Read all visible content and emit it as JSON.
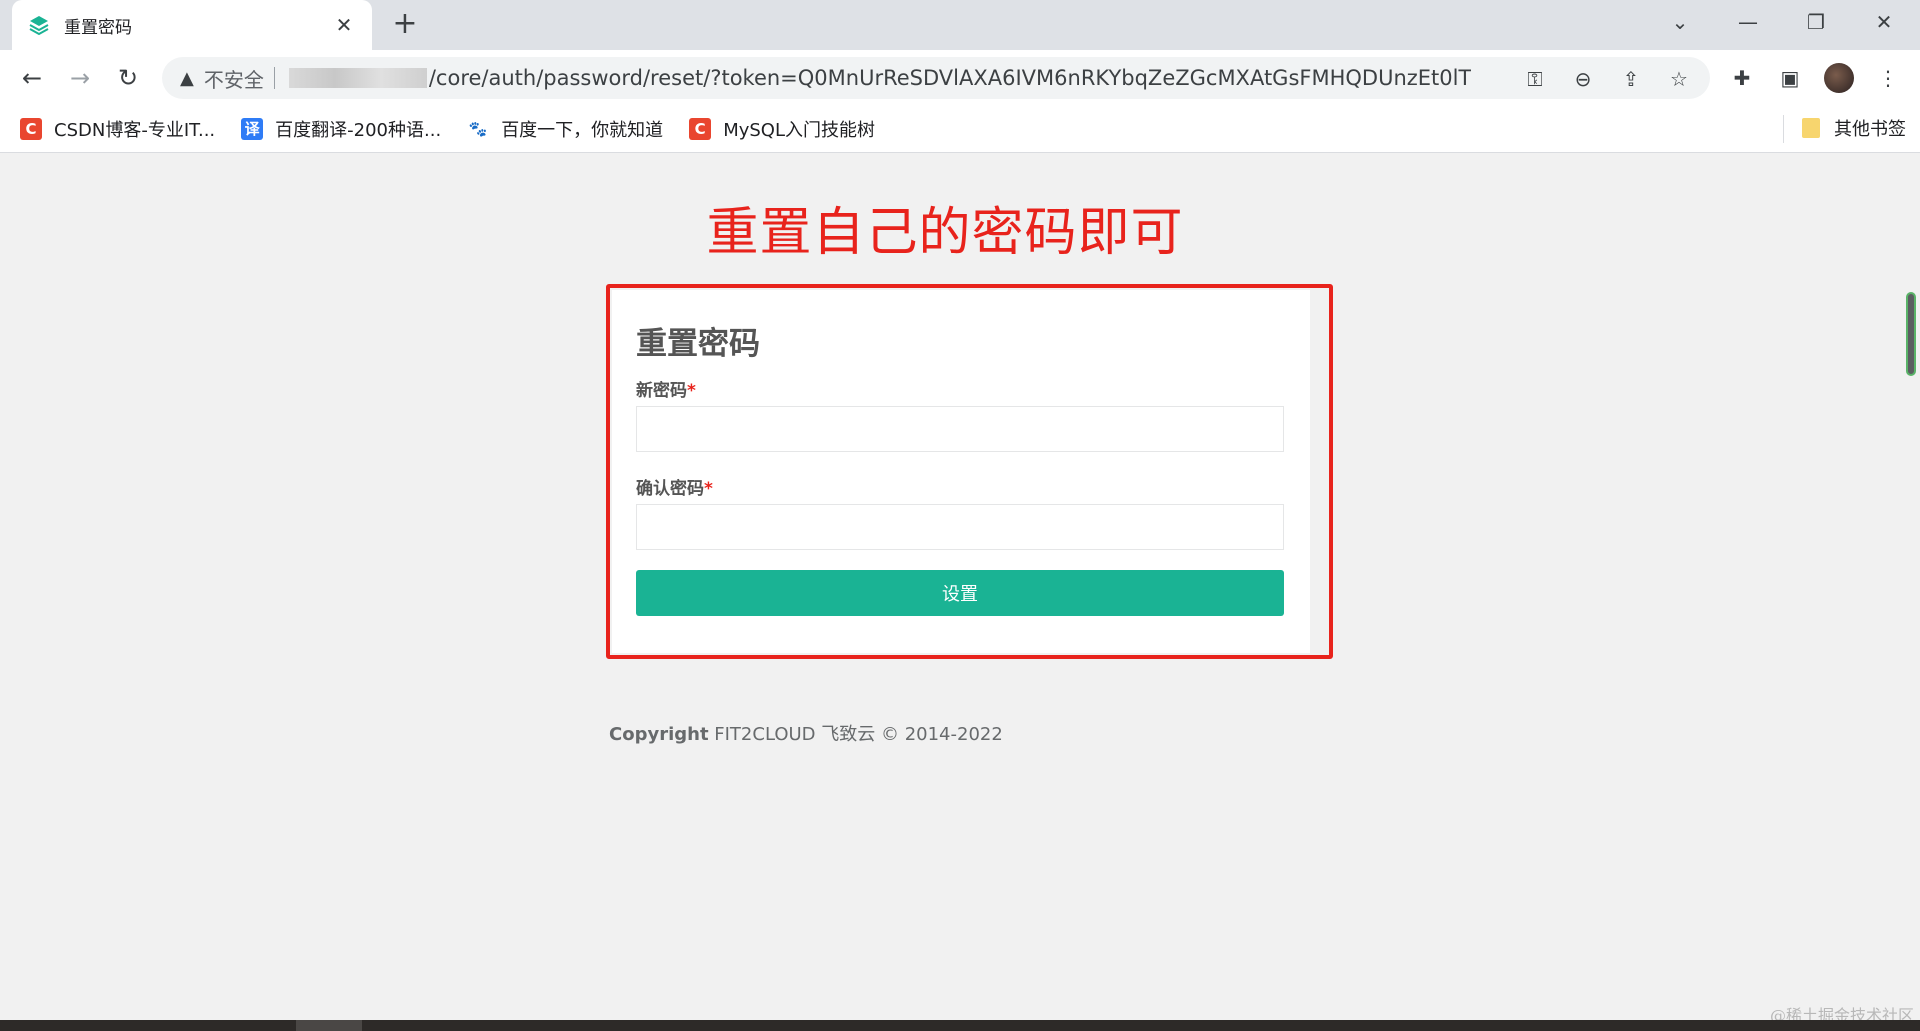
{
  "browser": {
    "tab_title": "重置密码",
    "tab_close": "✕",
    "new_tab": "+",
    "window_controls": {
      "dropdown": "⌄",
      "minimize": "—",
      "restore": "❐",
      "close": "✕"
    },
    "nav": {
      "back": "←",
      "forward": "→",
      "reload": "↻"
    },
    "security_label": "不安全",
    "url_visible": "/core/auth/password/reset/?token=Q0MnUrReSDVlAXA6IVM6nRKYbqZeZGcMXAtGsFMHQDUnzEt0lT",
    "bookmarks": [
      {
        "label": "CSDN博客-专业IT...",
        "icon": "C",
        "color": "#e9462f"
      },
      {
        "label": "百度翻译-200种语...",
        "icon": "译",
        "color": "#2f7cf6"
      },
      {
        "label": "百度一下，你就知道",
        "icon": "🐾",
        "color": "#2932e1"
      },
      {
        "label": "MySQL入门技能树",
        "icon": "C",
        "color": "#e9462f"
      }
    ],
    "other_bookmarks": "其他书签"
  },
  "page": {
    "annotation": "重置自己的密码即可",
    "form": {
      "title": "重置密码",
      "new_password_label": "新密码",
      "confirm_password_label": "确认密码",
      "required_mark": "*",
      "new_password_value": "",
      "confirm_password_value": "",
      "submit_label": "设置"
    },
    "copyright_bold": "Copyright",
    "copyright_rest": " FIT2CLOUD 飞致云 © 2014-2022",
    "watermark": "@稀土掘金技术社区"
  },
  "colors": {
    "accent_green": "#1ab394",
    "annotation_red": "#e8231c",
    "page_bg": "#f1f1f1"
  }
}
